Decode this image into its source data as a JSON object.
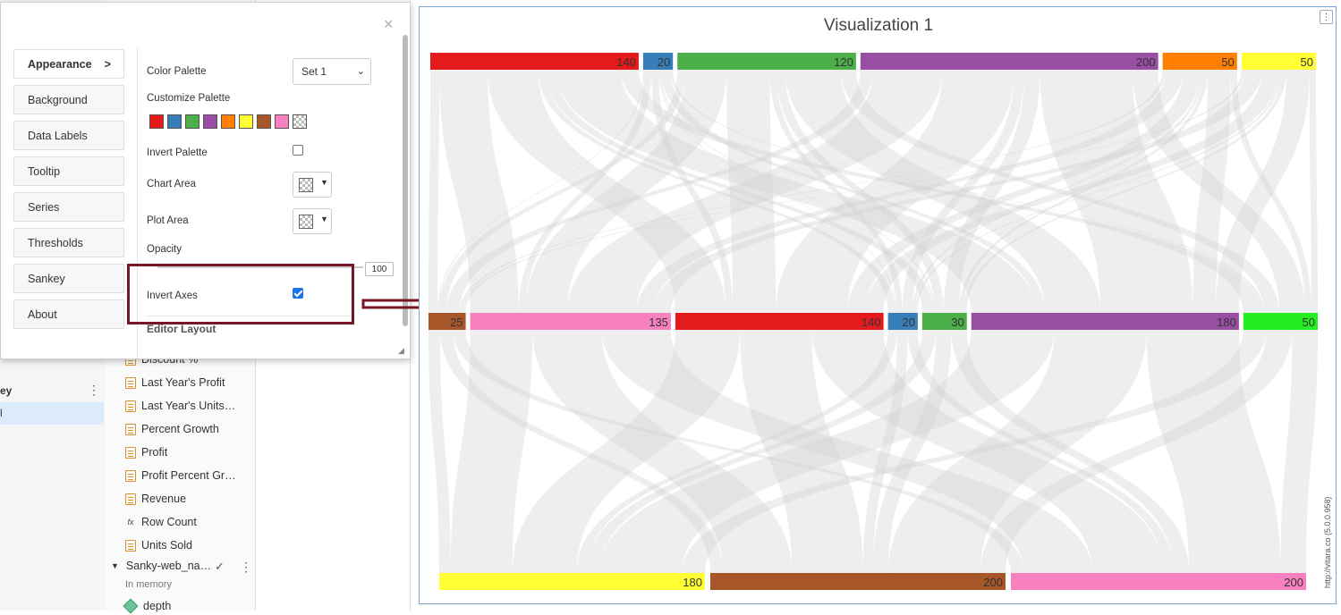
{
  "left_panel": {
    "section_label": "ey",
    "selected_item": "l"
  },
  "data_source": {
    "fields": [
      {
        "label": "Discount %",
        "icon": "measure-icon"
      },
      {
        "label": "Last Year's Profit",
        "icon": "measure-icon"
      },
      {
        "label": "Last Year's Units…",
        "icon": "measure-icon"
      },
      {
        "label": "Percent Growth",
        "icon": "measure-icon"
      },
      {
        "label": "Profit",
        "icon": "measure-icon"
      },
      {
        "label": "Profit Percent Gr…",
        "icon": "measure-icon"
      },
      {
        "label": "Revenue",
        "icon": "measure-icon"
      },
      {
        "label": "Row Count",
        "icon": "formula-icon"
      },
      {
        "label": "Units Sold",
        "icon": "measure-icon"
      }
    ],
    "group_name": "Sanky-web_na…",
    "group_status": "In memory",
    "child_field": "depth"
  },
  "editor": {
    "close_label": "×",
    "tabs": [
      {
        "label": "Appearance",
        "arrow": ">"
      },
      {
        "label": "Background"
      },
      {
        "label": "Data Labels"
      },
      {
        "label": "Tooltip"
      },
      {
        "label": "Series"
      },
      {
        "label": "Thresholds"
      },
      {
        "label": "Sankey"
      },
      {
        "label": "About"
      }
    ],
    "color_palette_label": "Color Palette",
    "color_palette_value": "Set 1",
    "customize_palette_label": "Customize Palette",
    "palette_colors": [
      "#e41a1c",
      "#377eb8",
      "#4daf4a",
      "#984ea3",
      "#ff7f00",
      "#ffff33",
      "#a65628",
      "#f781bf",
      "checker"
    ],
    "invert_palette_label": "Invert Palette",
    "invert_palette_checked": false,
    "chart_area_label": "Chart Area",
    "plot_area_label": "Plot Area",
    "opacity_label": "Opacity",
    "opacity_value": "100",
    "invert_axes_label": "Invert Axes",
    "invert_axes_checked": true,
    "editor_layout_label": "Editor Layout"
  },
  "visualization": {
    "title": "Visualization 1",
    "credit": "http://vitara.co (5.0.0.958)",
    "highlight_color": "#7a1524"
  },
  "chart_data": {
    "type": "sankey",
    "title": "Visualization 1",
    "levels": [
      [
        {
          "label": "140",
          "value": 140,
          "color": "#e41a1c"
        },
        {
          "label": "20",
          "value": 20,
          "color": "#377eb8"
        },
        {
          "label": "120",
          "value": 120,
          "color": "#4daf4a"
        },
        {
          "label": "200",
          "value": 200,
          "color": "#984ea3"
        },
        {
          "label": "50",
          "value": 50,
          "color": "#ff7f00"
        },
        {
          "label": "50",
          "value": 50,
          "color": "#ffff33"
        }
      ],
      [
        {
          "label": "25",
          "value": 25,
          "color": "#a65628"
        },
        {
          "label": "135",
          "value": 135,
          "color": "#f781bf"
        },
        {
          "label": "140",
          "value": 140,
          "color": "#e41a1c"
        },
        {
          "label": "20",
          "value": 20,
          "color": "#377eb8"
        },
        {
          "label": "30",
          "value": 30,
          "color": "#4daf4a"
        },
        {
          "label": "180",
          "value": 180,
          "color": "#984ea3"
        },
        {
          "label": "50",
          "value": 50,
          "color": "#22ee22"
        }
      ],
      [
        {
          "label": "180",
          "value": 180,
          "color": "#ffff33"
        },
        {
          "label": "200",
          "value": 200,
          "color": "#a65628"
        },
        {
          "label": "200",
          "value": 200,
          "color": "#f781bf"
        }
      ]
    ]
  }
}
